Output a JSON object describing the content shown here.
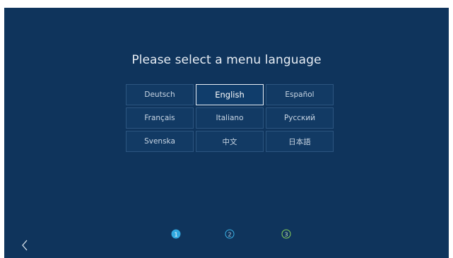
{
  "title": "Please select a menu language",
  "languages": [
    {
      "label": "Deutsch",
      "selected": false
    },
    {
      "label": "English",
      "selected": true
    },
    {
      "label": "Español",
      "selected": false
    },
    {
      "label": "Français",
      "selected": false
    },
    {
      "label": "Italiano",
      "selected": false
    },
    {
      "label": "Русский",
      "selected": false
    },
    {
      "label": "Svenska",
      "selected": false
    },
    {
      "label": "中文",
      "selected": false
    },
    {
      "label": "日本語",
      "selected": false
    }
  ],
  "steps": {
    "items": [
      "1",
      "2",
      "3"
    ],
    "current": 1,
    "colors": [
      "#31a8e0",
      "#3ab0e3",
      "#8ad45a"
    ]
  },
  "back_icon": "chevron-left-icon",
  "colors": {
    "background": "#0f345c",
    "selected_border": "#e7eef6"
  }
}
